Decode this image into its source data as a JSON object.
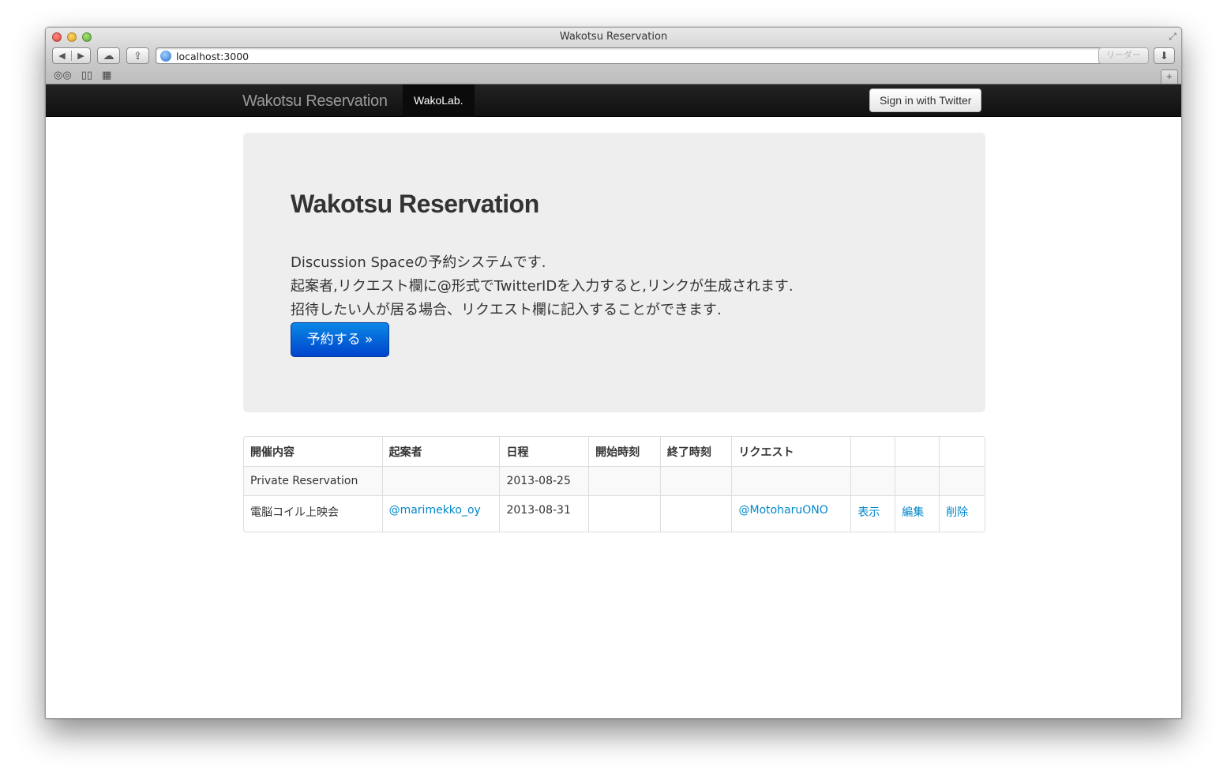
{
  "window": {
    "title": "Wakotsu Reservation",
    "url": "localhost:3000",
    "reader_label": "リーダー"
  },
  "navbar": {
    "brand": "Wakotsu Reservation",
    "active_item": "WakoLab.",
    "signin_label": "Sign in with Twitter"
  },
  "hero": {
    "title": "Wakotsu Reservation",
    "line1": "Discussion Spaceの予約システムです.",
    "line2": "起案者,リクエスト欄に@形式でTwitterIDを入力すると,リンクが生成されます.",
    "line3": "招待したい人が居る場合、リクエスト欄に記入することができます.",
    "button_label": "予約する »"
  },
  "table": {
    "headers": [
      "開催内容",
      "起案者",
      "日程",
      "開始時刻",
      "終了時刻",
      "リクエスト",
      "",
      "",
      ""
    ],
    "rows": [
      {
        "event": "Private Reservation",
        "organizer": "",
        "date": "2013-08-25",
        "start": "",
        "end": "",
        "request": "",
        "show": "",
        "edit": "",
        "delete": ""
      },
      {
        "event": "電脳コイル上映会",
        "organizer": "@marimekko_oy",
        "date": "2013-08-31",
        "start": "",
        "end": "",
        "request": "@MotoharuONO",
        "show": "表示",
        "edit": "編集",
        "delete": "削除"
      }
    ]
  },
  "colors": {
    "navbar_bg": "#111111",
    "hero_bg": "#eeeeee",
    "primary_button": "#0055cc",
    "link": "#0088cc"
  }
}
